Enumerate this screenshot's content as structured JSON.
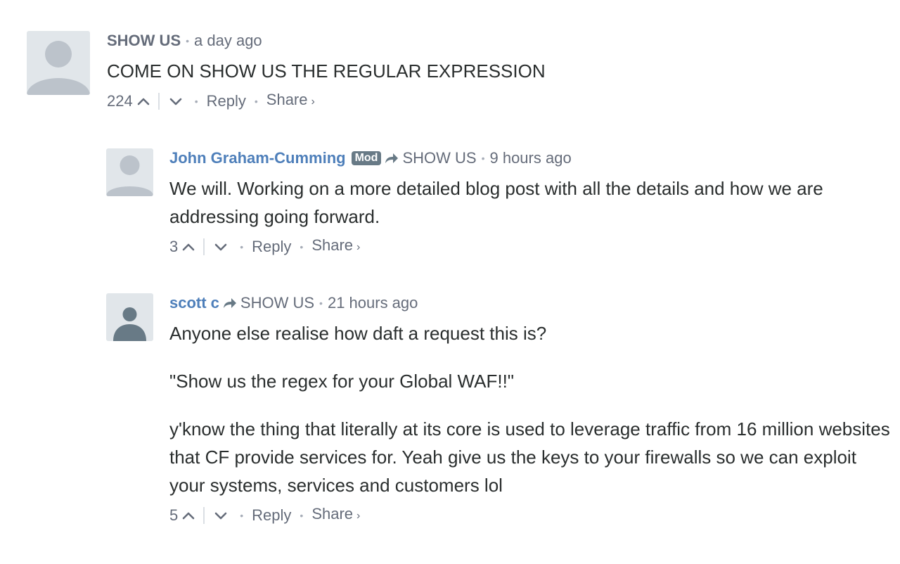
{
  "comments": [
    {
      "author": "SHOW US",
      "mod_badge": "",
      "reply_to": "",
      "time": "a day ago",
      "paragraphs": [
        "COME ON SHOW US THE REGULAR EXPRESSION"
      ],
      "votes": "224",
      "reply_label": "Reply",
      "share_label": "Share",
      "share_chevron": "›"
    },
    {
      "author": "John Graham-Cumming",
      "mod_badge": "Mod",
      "reply_to": "SHOW US",
      "time": "9 hours ago",
      "paragraphs": [
        "We will. Working on a more detailed blog post with all the details and how we are addressing going forward."
      ],
      "votes": "3",
      "reply_label": "Reply",
      "share_label": "Share",
      "share_chevron": "›"
    },
    {
      "author": "scott c",
      "mod_badge": "",
      "reply_to": "SHOW US",
      "time": "21 hours ago",
      "paragraphs": [
        "Anyone else realise how daft a request this is?",
        "\"Show us the regex for your Global WAF!!\"",
        "y'know the thing that literally at its core is used to leverage traffic from 16 million websites that CF provide services for. Yeah give us the keys to your firewalls so we can exploit your systems, services and customers lol"
      ],
      "votes": "5",
      "reply_label": "Reply",
      "share_label": "Share",
      "share_chevron": "›"
    }
  ],
  "separator_dot": "•",
  "colors": {
    "author_link": "#4e7fba",
    "meta": "#656c7a",
    "text": "#2a2e2e",
    "mod_badge_bg": "#687a86",
    "avatar_bg": "#e1e6ea",
    "avatar_figure": "#bcc3cb"
  },
  "icons": {
    "avatar": "default-avatar-icon",
    "reply_arrow": "reply-arrow-icon",
    "upvote": "chevron-up-icon",
    "downvote": "chevron-down-icon"
  }
}
